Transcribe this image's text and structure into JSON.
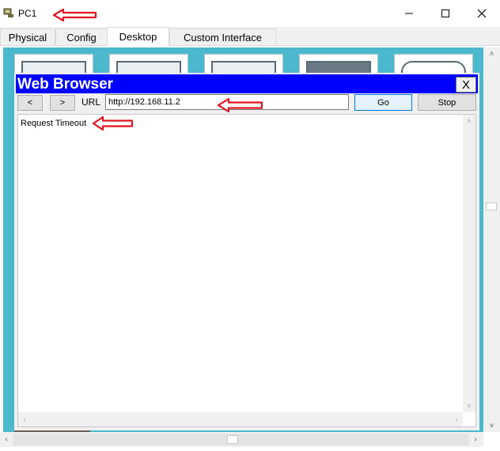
{
  "window": {
    "title": "PC1",
    "minimize_glyph": "—",
    "maximize_glyph": "☐",
    "close_glyph": "✕"
  },
  "tabs": [
    {
      "label": "Physical"
    },
    {
      "label": "Config"
    },
    {
      "label": "Desktop",
      "active": true
    },
    {
      "label": "Custom Interface"
    }
  ],
  "browser": {
    "title": "Web Browser",
    "close_label": "X",
    "back_label": "<",
    "forward_label": ">",
    "url_label": "URL",
    "url_value": "http://192.168.11.2",
    "go_label": "Go",
    "stop_label": "Stop",
    "content_text": "Request Timeout"
  },
  "scroll": {
    "up": "˄",
    "down": "˅",
    "left": "‹",
    "right": "›"
  },
  "colors": {
    "desktop_bg": "#4bb8cd",
    "browser_title_bg": "#0000ff",
    "annotation_arrow": "#e0141e"
  },
  "icons": [
    "pc-icon",
    "arrow-left-annotation-icon"
  ]
}
